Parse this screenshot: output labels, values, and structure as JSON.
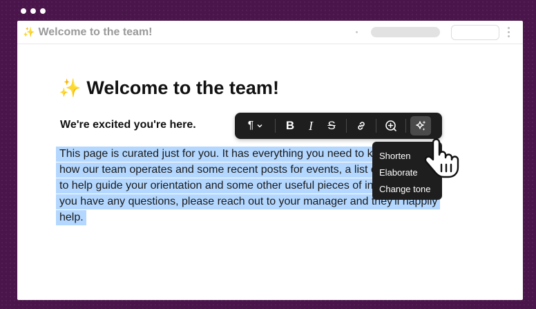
{
  "window": {
    "tab_title": "Welcome to the team!"
  },
  "document": {
    "heading": "Welcome to the team!",
    "subheading": "We're excited you're here.",
    "paragraph": "This page is curated just for you. It has everything you need to know about how our team operates and some recent posts for events, a list of resources to help guide your orientation and some other useful pieces of information. If you have any questions, please reach out to your manager and they'll happily help."
  },
  "toolbar": {
    "items": [
      {
        "name": "paragraph-style",
        "icon": "pilcrow-icon",
        "label": "¶"
      },
      {
        "name": "bold",
        "icon": "bold-icon",
        "label": "B"
      },
      {
        "name": "italic",
        "icon": "italic-icon",
        "label": "I"
      },
      {
        "name": "strikethrough",
        "icon": "strikethrough-icon",
        "label": "S"
      },
      {
        "name": "link",
        "icon": "link-icon"
      },
      {
        "name": "add-comment",
        "icon": "comment-plus-icon"
      },
      {
        "name": "ai-assist",
        "icon": "sparkle-icon"
      }
    ]
  },
  "ai_menu": {
    "items": [
      "Shorten",
      "Elaborate",
      "Change tone"
    ]
  },
  "colors": {
    "background": "#4a154b",
    "selection": "#b3d7ff",
    "toolbar": "#1e1e1e",
    "sparkle": "#e8b84a"
  }
}
